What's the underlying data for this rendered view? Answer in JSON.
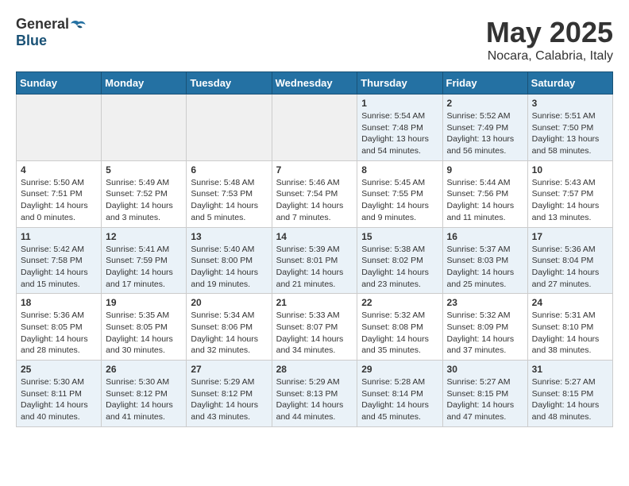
{
  "header": {
    "logo_general": "General",
    "logo_blue": "Blue",
    "month": "May 2025",
    "location": "Nocara, Calabria, Italy"
  },
  "weekdays": [
    "Sunday",
    "Monday",
    "Tuesday",
    "Wednesday",
    "Thursday",
    "Friday",
    "Saturday"
  ],
  "weeks": [
    [
      {
        "day": "",
        "empty": true
      },
      {
        "day": "",
        "empty": true
      },
      {
        "day": "",
        "empty": true
      },
      {
        "day": "",
        "empty": true
      },
      {
        "day": "1",
        "sunrise": "5:54 AM",
        "sunset": "7:48 PM",
        "daylight": "13 hours and 54 minutes."
      },
      {
        "day": "2",
        "sunrise": "5:52 AM",
        "sunset": "7:49 PM",
        "daylight": "13 hours and 56 minutes."
      },
      {
        "day": "3",
        "sunrise": "5:51 AM",
        "sunset": "7:50 PM",
        "daylight": "13 hours and 58 minutes."
      }
    ],
    [
      {
        "day": "4",
        "sunrise": "5:50 AM",
        "sunset": "7:51 PM",
        "daylight": "14 hours and 0 minutes."
      },
      {
        "day": "5",
        "sunrise": "5:49 AM",
        "sunset": "7:52 PM",
        "daylight": "14 hours and 3 minutes."
      },
      {
        "day": "6",
        "sunrise": "5:48 AM",
        "sunset": "7:53 PM",
        "daylight": "14 hours and 5 minutes."
      },
      {
        "day": "7",
        "sunrise": "5:46 AM",
        "sunset": "7:54 PM",
        "daylight": "14 hours and 7 minutes."
      },
      {
        "day": "8",
        "sunrise": "5:45 AM",
        "sunset": "7:55 PM",
        "daylight": "14 hours and 9 minutes."
      },
      {
        "day": "9",
        "sunrise": "5:44 AM",
        "sunset": "7:56 PM",
        "daylight": "14 hours and 11 minutes."
      },
      {
        "day": "10",
        "sunrise": "5:43 AM",
        "sunset": "7:57 PM",
        "daylight": "14 hours and 13 minutes."
      }
    ],
    [
      {
        "day": "11",
        "sunrise": "5:42 AM",
        "sunset": "7:58 PM",
        "daylight": "14 hours and 15 minutes."
      },
      {
        "day": "12",
        "sunrise": "5:41 AM",
        "sunset": "7:59 PM",
        "daylight": "14 hours and 17 minutes."
      },
      {
        "day": "13",
        "sunrise": "5:40 AM",
        "sunset": "8:00 PM",
        "daylight": "14 hours and 19 minutes."
      },
      {
        "day": "14",
        "sunrise": "5:39 AM",
        "sunset": "8:01 PM",
        "daylight": "14 hours and 21 minutes."
      },
      {
        "day": "15",
        "sunrise": "5:38 AM",
        "sunset": "8:02 PM",
        "daylight": "14 hours and 23 minutes."
      },
      {
        "day": "16",
        "sunrise": "5:37 AM",
        "sunset": "8:03 PM",
        "daylight": "14 hours and 25 minutes."
      },
      {
        "day": "17",
        "sunrise": "5:36 AM",
        "sunset": "8:04 PM",
        "daylight": "14 hours and 27 minutes."
      }
    ],
    [
      {
        "day": "18",
        "sunrise": "5:36 AM",
        "sunset": "8:05 PM",
        "daylight": "14 hours and 28 minutes."
      },
      {
        "day": "19",
        "sunrise": "5:35 AM",
        "sunset": "8:05 PM",
        "daylight": "14 hours and 30 minutes."
      },
      {
        "day": "20",
        "sunrise": "5:34 AM",
        "sunset": "8:06 PM",
        "daylight": "14 hours and 32 minutes."
      },
      {
        "day": "21",
        "sunrise": "5:33 AM",
        "sunset": "8:07 PM",
        "daylight": "14 hours and 34 minutes."
      },
      {
        "day": "22",
        "sunrise": "5:32 AM",
        "sunset": "8:08 PM",
        "daylight": "14 hours and 35 minutes."
      },
      {
        "day": "23",
        "sunrise": "5:32 AM",
        "sunset": "8:09 PM",
        "daylight": "14 hours and 37 minutes."
      },
      {
        "day": "24",
        "sunrise": "5:31 AM",
        "sunset": "8:10 PM",
        "daylight": "14 hours and 38 minutes."
      }
    ],
    [
      {
        "day": "25",
        "sunrise": "5:30 AM",
        "sunset": "8:11 PM",
        "daylight": "14 hours and 40 minutes."
      },
      {
        "day": "26",
        "sunrise": "5:30 AM",
        "sunset": "8:12 PM",
        "daylight": "14 hours and 41 minutes."
      },
      {
        "day": "27",
        "sunrise": "5:29 AM",
        "sunset": "8:12 PM",
        "daylight": "14 hours and 43 minutes."
      },
      {
        "day": "28",
        "sunrise": "5:29 AM",
        "sunset": "8:13 PM",
        "daylight": "14 hours and 44 minutes."
      },
      {
        "day": "29",
        "sunrise": "5:28 AM",
        "sunset": "8:14 PM",
        "daylight": "14 hours and 45 minutes."
      },
      {
        "day": "30",
        "sunrise": "5:27 AM",
        "sunset": "8:15 PM",
        "daylight": "14 hours and 47 minutes."
      },
      {
        "day": "31",
        "sunrise": "5:27 AM",
        "sunset": "8:15 PM",
        "daylight": "14 hours and 48 minutes."
      }
    ]
  ]
}
